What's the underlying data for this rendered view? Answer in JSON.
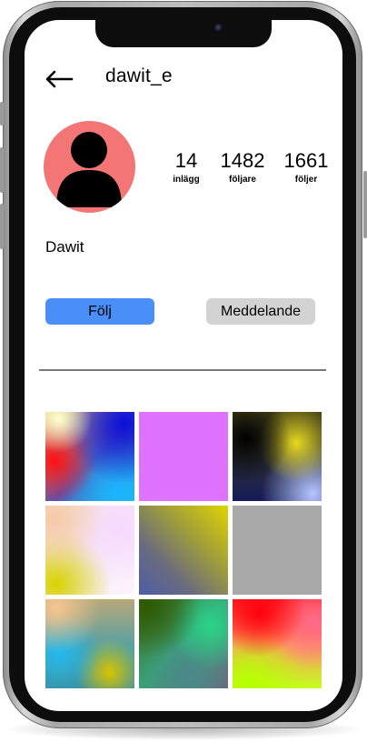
{
  "profile": {
    "username": "dawit_e",
    "display_name": "Dawit",
    "avatar_color": "#f47575",
    "stats": [
      {
        "value": "14",
        "label": "inlägg"
      },
      {
        "value": "1482",
        "label": "följare"
      },
      {
        "value": "1661",
        "label": "följer"
      }
    ]
  },
  "actions": {
    "follow_label": "Följ",
    "follow_color": "#4a8ff7",
    "message_label": "Meddelande",
    "message_color": "#d3d3d3"
  },
  "icons": {
    "back": "arrow-left-icon",
    "avatar": "person-silhouette-icon"
  },
  "posts": [
    {
      "background": "radial-gradient(circle at 15% 8%, #ffffd0 0%, rgba(255,255,208,0) 30%), radial-gradient(circle at 88% 12%, #0a10d8 0%, rgba(10,16,216,0) 55%), radial-gradient(circle at 10% 55%, #ff1010 0%, rgba(255,16,16,0) 45%), radial-gradient(circle at 80% 92%, #19b6ff 0%, rgba(25,182,255,0) 55%), linear-gradient(135deg, #e8c070 0%, #5a4fb0 55%, #22b8e8 100%)"
    },
    {
      "background": "#df72ff"
    },
    {
      "background": "radial-gradient(circle at 15% 30%, #000000 0%, rgba(0,0,0,0) 45%), radial-gradient(circle at 72% 35%, #e8da1e 0%, rgba(232,218,30,0) 45%), radial-gradient(circle at 90% 92%, #b6c6ff 0%, rgba(182,198,255,0) 45%), linear-gradient(180deg, #4a4414 0%, #141b58 100%)"
    },
    {
      "background": "radial-gradient(circle at 10% 15%, #f7c9a8 0%, rgba(247,201,168,0) 45%), radial-gradient(circle at 85% 25%, #f7d8ff 0%, rgba(247,216,255,0) 55%), radial-gradient(circle at 12% 88%, #d8d200 0%, rgba(216,210,0,0) 50%), linear-gradient(135deg, #f0e0c8 0%, #f6e8f4 50%, #fdf4ff 100%)"
    },
    {
      "background": "linear-gradient(45deg, #4e5ea8 0%, #6a6a80 30%, #9b9a40 60%, #e0d400 100%)"
    },
    {
      "background": "#a9a9a9"
    },
    {
      "background": "radial-gradient(circle at 12% 10%, #f7c690 0%, rgba(247,198,144,0) 40%), radial-gradient(circle at 15% 60%, #22b8ee 0%, rgba(34,184,238,0) 45%), radial-gradient(circle at 72% 82%, #d8c400 0%, rgba(216,196,0,0) 35%), linear-gradient(180deg, #b8a878 0%, #4aa0a8 60%, #3a90a0 100%)"
    },
    {
      "background": "radial-gradient(circle at 10% 8%, #2e5a06 0%, rgba(46,90,6,0) 45%), radial-gradient(circle at 82% 30%, #2ad488 0%, rgba(42,212,136,0) 45%), radial-gradient(circle at 55% 85%, #4a8a8a 0%, rgba(74,138,138,0) 45%), linear-gradient(135deg, #3c6a14 0%, #3aa07a 50%, #6a6a80 100%)"
    },
    {
      "background": "radial-gradient(circle at 30% 15%, #ff0010 0%, rgba(255,0,16,0) 45%), radial-gradient(circle at 92% 25%, #ff6a8c 0%, rgba(255,106,140,0) 45%), radial-gradient(circle at 20% 95%, #b6ff00 0%, rgba(182,255,0,0) 50%), linear-gradient(180deg, #ff2020 0%, #ff9a60 50%, #c4ff20 100%)"
    }
  ]
}
